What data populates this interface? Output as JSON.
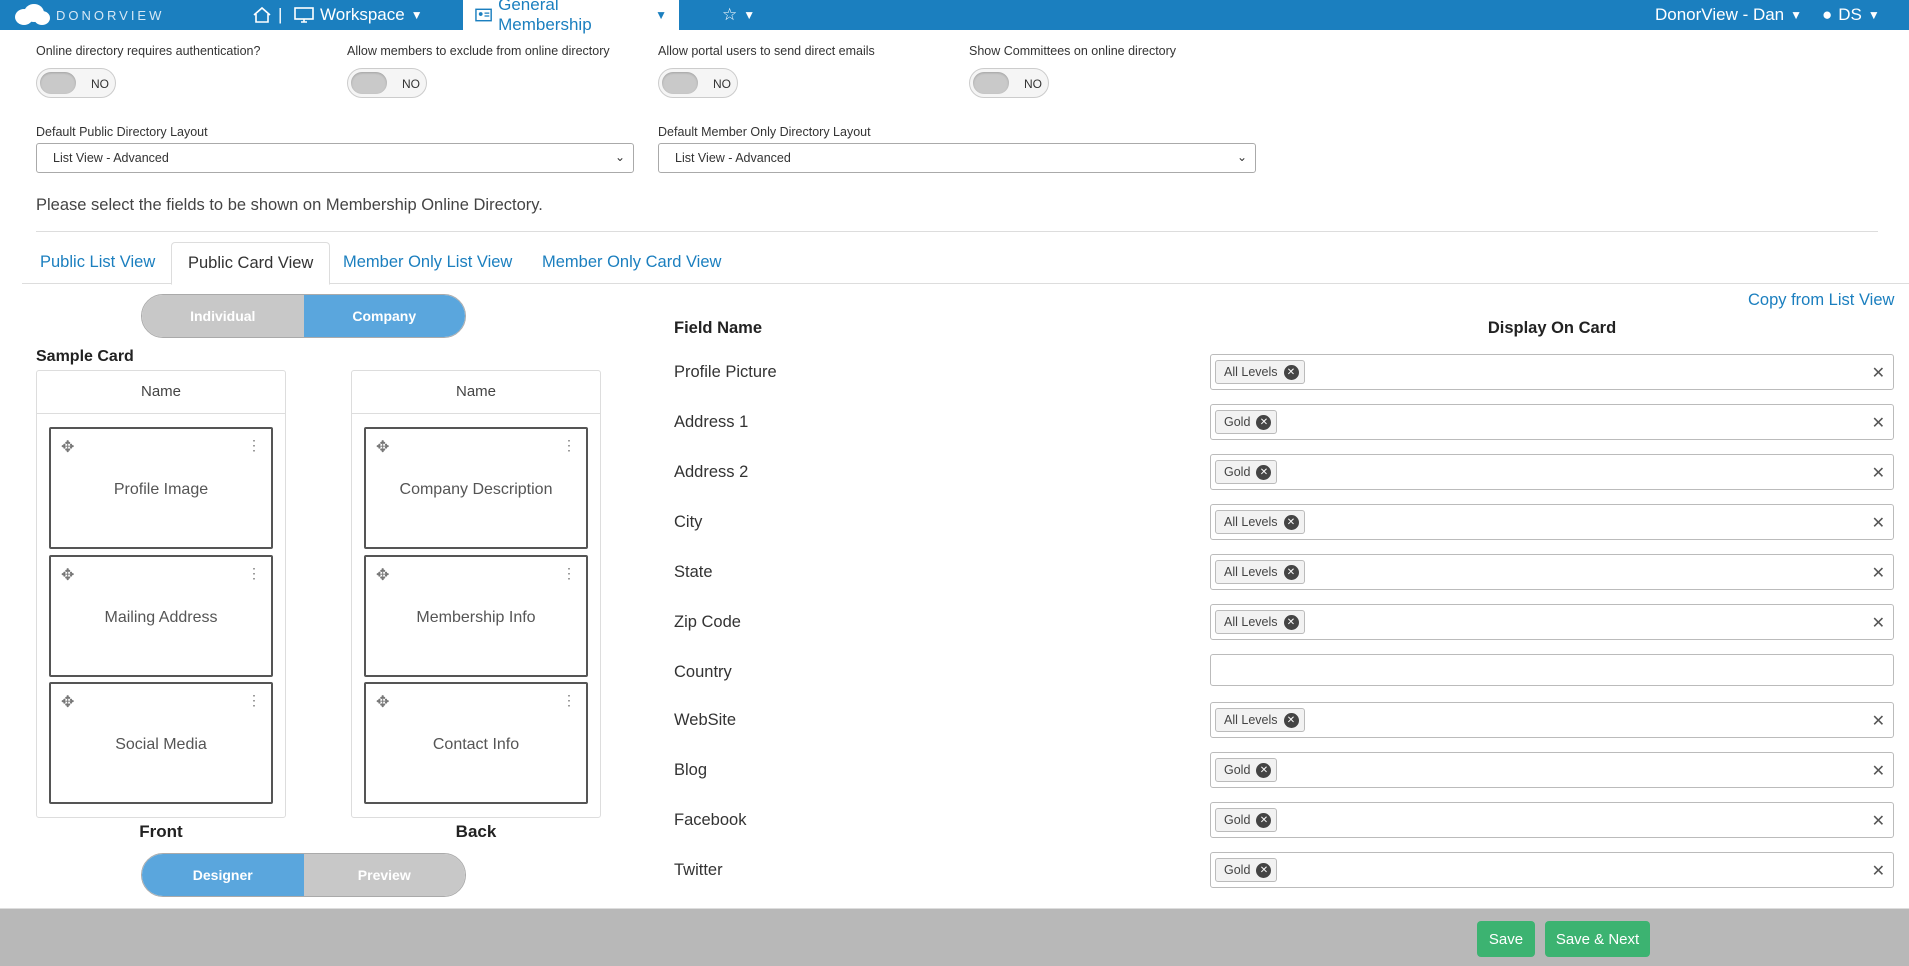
{
  "nav": {
    "brand": "DONORVIEW",
    "workspace": "Workspace",
    "current": "General Membership",
    "user": "DonorView - Dan",
    "account": "DS"
  },
  "settings": [
    {
      "label": "Online directory requires authentication?",
      "value": "NO"
    },
    {
      "label": "Allow members to exclude from online directory",
      "value": "NO"
    },
    {
      "label": "Allow portal users to send direct emails",
      "value": "NO"
    },
    {
      "label": "Show Committees on online directory",
      "value": "NO"
    }
  ],
  "layouts": {
    "public_label": "Default Public Directory Layout",
    "public_value": "List View - Advanced",
    "member_label": "Default Member Only Directory Layout",
    "member_value": "List View - Advanced"
  },
  "intro": "Please select the fields to be shown on Membership Online Directory.",
  "tabs": [
    "Public List View",
    "Public Card View",
    "Member Only List View",
    "Member Only Card View"
  ],
  "type_toggle": {
    "individual": "Individual",
    "company": "Company"
  },
  "sample": {
    "title": "Sample Card",
    "front": {
      "name": "Name",
      "blocks": [
        "Profile Image",
        "Mailing Address",
        "Social Media"
      ],
      "caption": "Front"
    },
    "back": {
      "name": "Name",
      "blocks": [
        "Company Description",
        "Membership Info",
        "Contact Info"
      ],
      "caption": "Back"
    }
  },
  "mode_toggle": {
    "designer": "Designer",
    "preview": "Preview"
  },
  "right": {
    "copy_link": "Copy from List View",
    "col_field": "Field Name",
    "col_display": "Display On Card",
    "fields": [
      {
        "name": "Profile Picture",
        "tag": "All Levels"
      },
      {
        "name": "Address 1",
        "tag": "Gold"
      },
      {
        "name": "Address 2",
        "tag": "Gold"
      },
      {
        "name": "City",
        "tag": "All Levels"
      },
      {
        "name": "State",
        "tag": "All Levels"
      },
      {
        "name": "Zip Code",
        "tag": "All Levels"
      },
      {
        "name": "Country",
        "tag": ""
      },
      {
        "name": "WebSite",
        "tag": "All Levels"
      },
      {
        "name": "Blog",
        "tag": "Gold"
      },
      {
        "name": "Facebook",
        "tag": "Gold"
      },
      {
        "name": "Twitter",
        "tag": "Gold"
      }
    ]
  },
  "footer": {
    "save": "Save",
    "save_next": "Save & Next"
  },
  "colors": {
    "brand": "#1b7fbf",
    "segment_on": "#5aa6dd",
    "save": "#3cb371"
  }
}
